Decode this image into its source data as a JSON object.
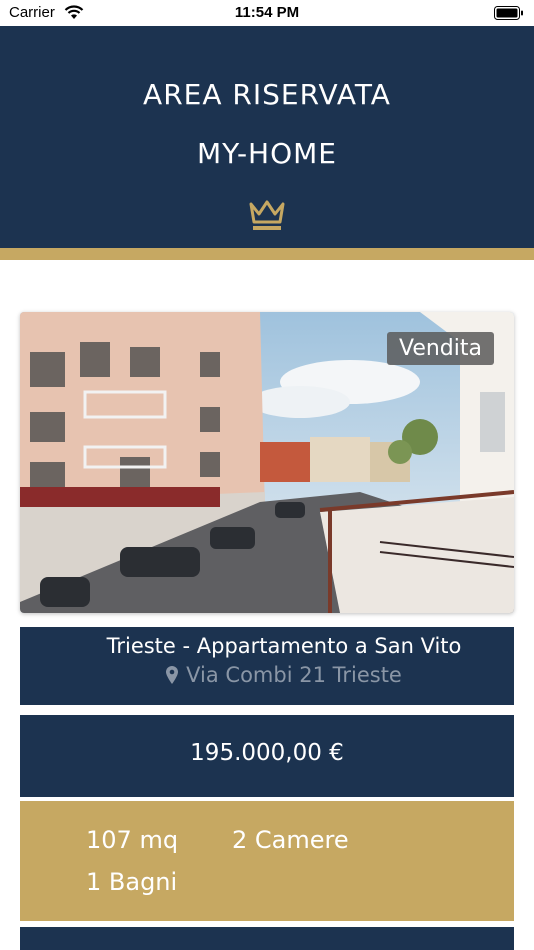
{
  "status_bar": {
    "carrier": "Carrier",
    "time": "11:54 PM"
  },
  "header": {
    "title_line1": "AREA RISERVATA",
    "title_line2": "MY-HOME",
    "icon": "crown-icon",
    "background_color": "#1c3350",
    "accent_color": "#c6a862"
  },
  "listing": {
    "badge": "Vendita",
    "title": "Trieste - Appartamento a San Vito",
    "address": "Via Combi 21 Trieste",
    "price": "195.000,00 €",
    "features": {
      "area": "107 mq",
      "rooms": "2 Camere",
      "bathrooms": "1 Bagni"
    }
  }
}
